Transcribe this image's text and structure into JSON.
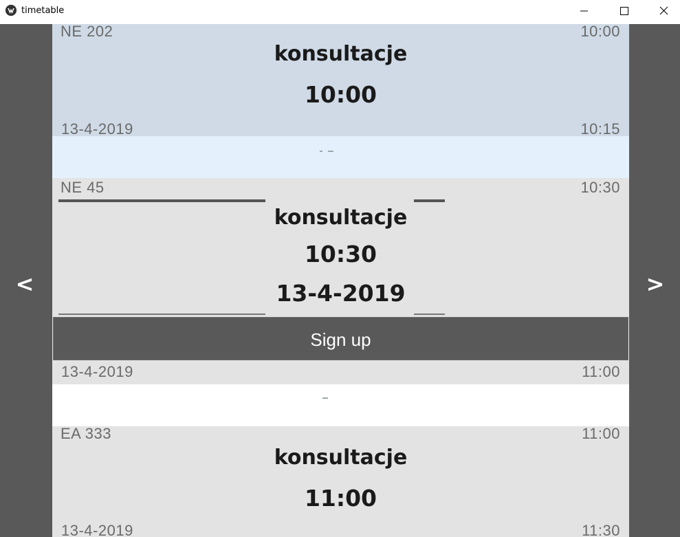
{
  "window": {
    "title": "timetable",
    "minimize_label": "",
    "maximize_label": "",
    "close_label": ""
  },
  "nav": {
    "prev_label": "<",
    "next_label": ">"
  },
  "slots": [
    {
      "room": "NE 202",
      "start": "10:00",
      "title": "konsultacje",
      "time": "10:00",
      "date": "13-4-2019",
      "end": "10:15",
      "background": "#cfdae6"
    },
    {
      "room": "NE 45",
      "start": "10:30",
      "title": "konsultacje",
      "time": "10:30",
      "date_big": "13-4-2019",
      "button": "Sign up",
      "date": "13-4-2019",
      "end": "11:00",
      "background": "#e3e3e3",
      "selected": true
    },
    {
      "room": "EA 333",
      "start": "11:00",
      "title": "konsultacje",
      "time": "11:00",
      "date": "13-4-2019",
      "end": "11:30",
      "background": "#e3e3e3"
    }
  ],
  "gaps": [
    {
      "background": "#e4f0fc"
    },
    {
      "background": "#ffffff"
    }
  ],
  "colors": {
    "frame": "#595959",
    "titlebar": "#ffffff",
    "button": "#595959"
  }
}
